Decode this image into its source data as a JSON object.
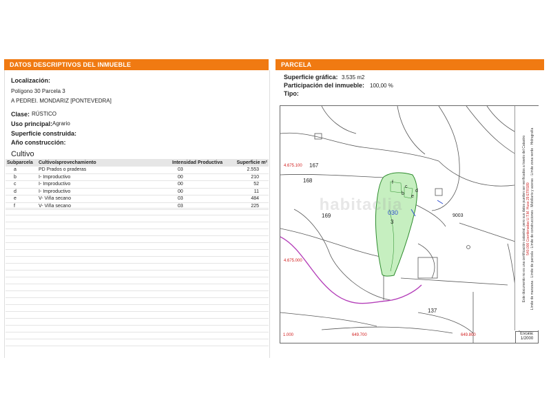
{
  "left": {
    "header": "DATOS DESCRIPTIVOS DEL INMUEBLE",
    "localizacion_label": "Localización:",
    "address_line1": "Polígono 30 Parcela 3",
    "address_line2": "A PEDREI. MONDARIZ [PONTEVEDRA]",
    "clase_label": "Clase:",
    "clase_value": "RÚSTICO",
    "uso_label": "Uso principal:",
    "uso_value": "Agrario",
    "superficie_label": "Superficie construida:",
    "anio_label": "Año construcción:",
    "cultivo_title": "Cultivo",
    "table": {
      "headers": [
        "Subparcela",
        "Cultivo/aprovechamiento",
        "Intensidad Productiva",
        "Superficie m²"
      ],
      "rows": [
        [
          "a",
          "PD Prados o praderas",
          "03",
          "2.553"
        ],
        [
          "b",
          "I- Improductivo",
          "00",
          "210"
        ],
        [
          "c",
          "I- Improductivo",
          "00",
          "52"
        ],
        [
          "d",
          "I- Improductivo",
          "00",
          "11"
        ],
        [
          "e",
          "V- Viña secano",
          "03",
          "484"
        ],
        [
          "f",
          "V- Viña secano",
          "03",
          "225"
        ]
      ]
    }
  },
  "right": {
    "header": "PARCELA",
    "superficie_label": "Superficie gráfica:",
    "superficie_value": "3.535 m2",
    "participacion_label": "Participación del inmueble:",
    "participacion_value": "100,00 %",
    "tipo_label": "Tipo:",
    "map": {
      "labels": {
        "p167": "167",
        "p168": "168",
        "p169": "169",
        "p137": "137",
        "p9003": "9003",
        "p030": "030",
        "p3": "3",
        "pf": "f",
        "pc": "c",
        "pe": "e",
        "pd": "d",
        "pb": "b"
      },
      "coords": {
        "y1": "4.675.100",
        "y2": "4.675.000",
        "x0": "1.000",
        "x1": "649.700",
        "x2": "649.800"
      },
      "legend_lines": [
        "Límite de manzana",
        "Límite de parcela",
        "Límite de construcciones",
        "Mobiliario y aceras",
        "Límite zona verde",
        "Hidrografía"
      ],
      "legend_coord_note": "540.000 Coordenadas U.T.M. Huso 29 ETRS89",
      "legend_disclaimer": "Este documento no es una certificación catastral, pero sus datos pueden ser verificados a través del Catastro",
      "scale_label": "Escala:",
      "scale_value": "1/2000"
    }
  },
  "watermark": "habitaclia",
  "colors": {
    "accent": "#f07a12",
    "parcel_fill": "#c6efc0",
    "road_line": "#b43fb9",
    "coord_text": "#d22020"
  }
}
